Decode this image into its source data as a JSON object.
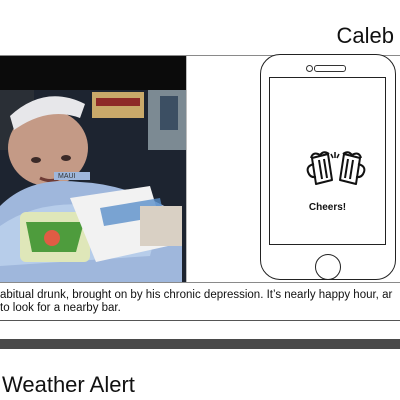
{
  "profile": {
    "name": "Caleb"
  },
  "video": {
    "alt_icon": "video-frame",
    "shirt_text": "MAUI"
  },
  "phone": {
    "icon": "beer-mugs-icon",
    "label": "Cheers!"
  },
  "story": {
    "line1": "abitual drunk, brought on by his chronic depression. It’s nearly happy hour, ar",
    "line2": "to look for a nearby bar."
  },
  "next_section": {
    "title": "Weather Alert"
  }
}
